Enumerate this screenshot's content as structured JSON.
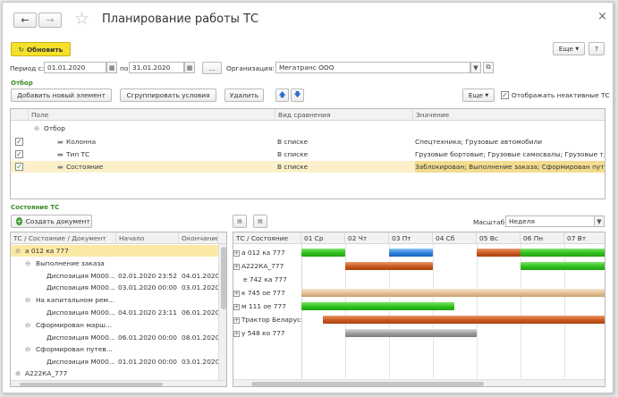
{
  "window": {
    "title": "Планирование работы ТС",
    "close_glyph": "×"
  },
  "toolbar": {
    "refresh_label": "Обновить",
    "more_label": "Еще",
    "help_label": "?"
  },
  "period": {
    "from_label": "Период с:",
    "from_value": "01.01.2020",
    "to_label": "по:",
    "to_value": "31.01.2020",
    "dots_label": "...",
    "org_label": "Организация:",
    "org_value": "Мегатранс ООО"
  },
  "filter": {
    "section_title": "Отбор",
    "add_label": "Добавить новый элемент",
    "group_label": "Сгруппировать условия",
    "delete_label": "Удалить",
    "more_label": "Еще",
    "show_inactive_label": "Отображать неактивные ТС",
    "columns": [
      "Поле",
      "Вид сравнения",
      "Значение"
    ],
    "group_row": "Отбор",
    "rows": [
      {
        "field": "Колонна",
        "compare": "В списке",
        "value": "Спецтехника; Грузовые автомобили"
      },
      {
        "field": "Тип ТС",
        "compare": "В списке",
        "value": "Грузовые бортовые; Грузовые самосвалы; Грузовые т..."
      },
      {
        "field": "Состояние",
        "compare": "В списке",
        "value": "Заблокирован; Выполнение заказа; Сформирован путе..."
      }
    ]
  },
  "state": {
    "section_title": "Состояние ТС",
    "create_doc_label": "Создать документ",
    "columns": [
      "ТС / Состояние / Документ",
      "Начало",
      "Окончание"
    ],
    "rows": [
      {
        "name": "а 012 ка 777",
        "start": "",
        "end": ""
      },
      {
        "name": "Выполнение заказа",
        "start": "",
        "end": ""
      },
      {
        "name": "Диспозиция М000...",
        "start": "02.01.2020 23:52",
        "end": "04.01.2020"
      },
      {
        "name": "Диспозиция М000...",
        "start": "03.01.2020 00:00",
        "end": "03.01.2020"
      },
      {
        "name": "На капитальном рем...",
        "start": "",
        "end": ""
      },
      {
        "name": "Диспозиция М000...",
        "start": "04.01.2020 23:11",
        "end": "06.01.2020"
      },
      {
        "name": "Сформирован марш...",
        "start": "",
        "end": ""
      },
      {
        "name": "Диспозиция М000...",
        "start": "06.01.2020 00:00",
        "end": "08.01.2020"
      },
      {
        "name": "Сформирован путев...",
        "start": "",
        "end": ""
      },
      {
        "name": "Диспозиция М000...",
        "start": "01.01.2020 00:00",
        "end": "03.01.2020"
      },
      {
        "name": "А222КА_777",
        "start": "",
        "end": ""
      }
    ]
  },
  "gantt": {
    "scale_label": "Масштаб:",
    "scale_value": "Неделя",
    "header_first": "ТС / Состояние",
    "days": [
      "01 Ср",
      "02 Чт",
      "03 Пт",
      "04 Сб",
      "05 Вс",
      "06 Пн",
      "07 Вт"
    ],
    "rows": [
      "а 012 ка 777",
      "А222КА_777",
      "е 742 ка 777",
      "к 745 ое 777",
      "м 111 ое 777",
      "Трактор Беларусь",
      "у 548 ко 777"
    ],
    "colors": {
      "green": "#35c51e",
      "blue": "#2f7fdc",
      "orange": "#c8581e",
      "beige": "#e9c9a0",
      "gray": "#9a9a9a"
    }
  }
}
